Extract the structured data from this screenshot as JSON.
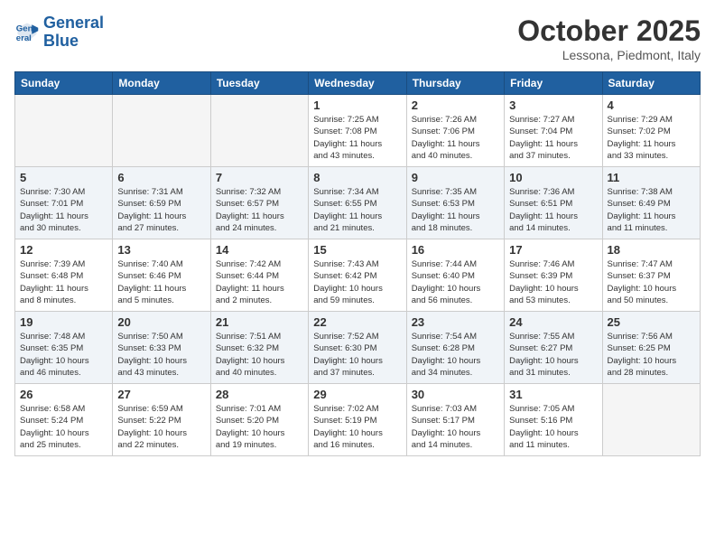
{
  "header": {
    "logo_line1": "General",
    "logo_line2": "Blue",
    "month": "October 2025",
    "location": "Lessona, Piedmont, Italy"
  },
  "weekdays": [
    "Sunday",
    "Monday",
    "Tuesday",
    "Wednesday",
    "Thursday",
    "Friday",
    "Saturday"
  ],
  "weeks": [
    [
      {
        "day": "",
        "info": ""
      },
      {
        "day": "",
        "info": ""
      },
      {
        "day": "",
        "info": ""
      },
      {
        "day": "1",
        "info": "Sunrise: 7:25 AM\nSunset: 7:08 PM\nDaylight: 11 hours\nand 43 minutes."
      },
      {
        "day": "2",
        "info": "Sunrise: 7:26 AM\nSunset: 7:06 PM\nDaylight: 11 hours\nand 40 minutes."
      },
      {
        "day": "3",
        "info": "Sunrise: 7:27 AM\nSunset: 7:04 PM\nDaylight: 11 hours\nand 37 minutes."
      },
      {
        "day": "4",
        "info": "Sunrise: 7:29 AM\nSunset: 7:02 PM\nDaylight: 11 hours\nand 33 minutes."
      }
    ],
    [
      {
        "day": "5",
        "info": "Sunrise: 7:30 AM\nSunset: 7:01 PM\nDaylight: 11 hours\nand 30 minutes."
      },
      {
        "day": "6",
        "info": "Sunrise: 7:31 AM\nSunset: 6:59 PM\nDaylight: 11 hours\nand 27 minutes."
      },
      {
        "day": "7",
        "info": "Sunrise: 7:32 AM\nSunset: 6:57 PM\nDaylight: 11 hours\nand 24 minutes."
      },
      {
        "day": "8",
        "info": "Sunrise: 7:34 AM\nSunset: 6:55 PM\nDaylight: 11 hours\nand 21 minutes."
      },
      {
        "day": "9",
        "info": "Sunrise: 7:35 AM\nSunset: 6:53 PM\nDaylight: 11 hours\nand 18 minutes."
      },
      {
        "day": "10",
        "info": "Sunrise: 7:36 AM\nSunset: 6:51 PM\nDaylight: 11 hours\nand 14 minutes."
      },
      {
        "day": "11",
        "info": "Sunrise: 7:38 AM\nSunset: 6:49 PM\nDaylight: 11 hours\nand 11 minutes."
      }
    ],
    [
      {
        "day": "12",
        "info": "Sunrise: 7:39 AM\nSunset: 6:48 PM\nDaylight: 11 hours\nand 8 minutes."
      },
      {
        "day": "13",
        "info": "Sunrise: 7:40 AM\nSunset: 6:46 PM\nDaylight: 11 hours\nand 5 minutes."
      },
      {
        "day": "14",
        "info": "Sunrise: 7:42 AM\nSunset: 6:44 PM\nDaylight: 11 hours\nand 2 minutes."
      },
      {
        "day": "15",
        "info": "Sunrise: 7:43 AM\nSunset: 6:42 PM\nDaylight: 10 hours\nand 59 minutes."
      },
      {
        "day": "16",
        "info": "Sunrise: 7:44 AM\nSunset: 6:40 PM\nDaylight: 10 hours\nand 56 minutes."
      },
      {
        "day": "17",
        "info": "Sunrise: 7:46 AM\nSunset: 6:39 PM\nDaylight: 10 hours\nand 53 minutes."
      },
      {
        "day": "18",
        "info": "Sunrise: 7:47 AM\nSunset: 6:37 PM\nDaylight: 10 hours\nand 50 minutes."
      }
    ],
    [
      {
        "day": "19",
        "info": "Sunrise: 7:48 AM\nSunset: 6:35 PM\nDaylight: 10 hours\nand 46 minutes."
      },
      {
        "day": "20",
        "info": "Sunrise: 7:50 AM\nSunset: 6:33 PM\nDaylight: 10 hours\nand 43 minutes."
      },
      {
        "day": "21",
        "info": "Sunrise: 7:51 AM\nSunset: 6:32 PM\nDaylight: 10 hours\nand 40 minutes."
      },
      {
        "day": "22",
        "info": "Sunrise: 7:52 AM\nSunset: 6:30 PM\nDaylight: 10 hours\nand 37 minutes."
      },
      {
        "day": "23",
        "info": "Sunrise: 7:54 AM\nSunset: 6:28 PM\nDaylight: 10 hours\nand 34 minutes."
      },
      {
        "day": "24",
        "info": "Sunrise: 7:55 AM\nSunset: 6:27 PM\nDaylight: 10 hours\nand 31 minutes."
      },
      {
        "day": "25",
        "info": "Sunrise: 7:56 AM\nSunset: 6:25 PM\nDaylight: 10 hours\nand 28 minutes."
      }
    ],
    [
      {
        "day": "26",
        "info": "Sunrise: 6:58 AM\nSunset: 5:24 PM\nDaylight: 10 hours\nand 25 minutes."
      },
      {
        "day": "27",
        "info": "Sunrise: 6:59 AM\nSunset: 5:22 PM\nDaylight: 10 hours\nand 22 minutes."
      },
      {
        "day": "28",
        "info": "Sunrise: 7:01 AM\nSunset: 5:20 PM\nDaylight: 10 hours\nand 19 minutes."
      },
      {
        "day": "29",
        "info": "Sunrise: 7:02 AM\nSunset: 5:19 PM\nDaylight: 10 hours\nand 16 minutes."
      },
      {
        "day": "30",
        "info": "Sunrise: 7:03 AM\nSunset: 5:17 PM\nDaylight: 10 hours\nand 14 minutes."
      },
      {
        "day": "31",
        "info": "Sunrise: 7:05 AM\nSunset: 5:16 PM\nDaylight: 10 hours\nand 11 minutes."
      },
      {
        "day": "",
        "info": ""
      }
    ]
  ]
}
